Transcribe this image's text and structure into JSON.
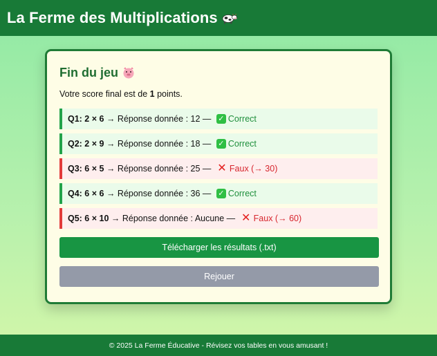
{
  "header": {
    "title": "La Ferme des Multiplications",
    "icon": "cow-icon"
  },
  "card": {
    "title": "Fin du jeu",
    "title_icon": "pig-icon",
    "score_prefix": "Votre score final est de ",
    "score_value": "1",
    "score_suffix": " points."
  },
  "results": [
    {
      "label": "Q1: 2 × 6",
      "answer_text": " → Réponse donnée : 12 — ",
      "status": "Correct",
      "correct": true
    },
    {
      "label": "Q2: 2 × 9",
      "answer_text": " → Réponse donnée : 18 — ",
      "status": "Correct",
      "correct": true
    },
    {
      "label": "Q3: 6 × 5",
      "answer_text": " → Réponse donnée : 25 — ",
      "status": "Faux (→ 30)",
      "correct": false
    },
    {
      "label": "Q4: 6 × 6",
      "answer_text": " → Réponse donnée : 36 — ",
      "status": "Correct",
      "correct": true
    },
    {
      "label": "Q5: 6 × 10",
      "answer_text": " → Réponse donnée : Aucune — ",
      "status": "Faux (→ 60)",
      "correct": false
    }
  ],
  "buttons": {
    "download_label": "Télécharger les résultats (.txt)",
    "replay_label": "Rejouer"
  },
  "footer": {
    "text": "© 2025 La Ferme Éducative - Révisez vos tables en vous amusant !"
  },
  "colors": {
    "primary": "#187a37",
    "success": "#1f8f3c",
    "error": "#d7262e",
    "card_bg": "#fefde6",
    "muted_button": "#949aa8"
  }
}
